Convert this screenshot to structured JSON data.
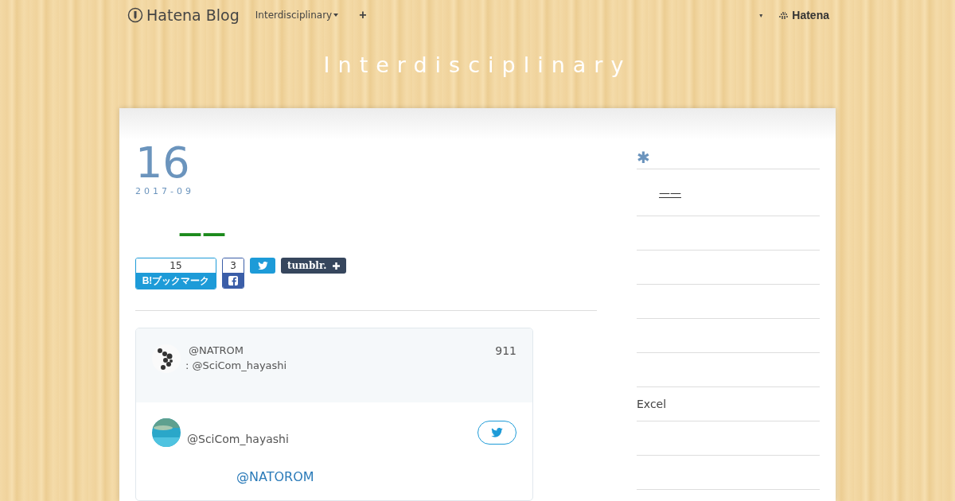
{
  "navbar": {
    "logo": "Hatena Blog",
    "blog_menu": "Interdisciplinary",
    "add": "+",
    "account_caret": "▾",
    "hatena": "Hatena"
  },
  "blog_title": "Interdisciplinary",
  "entry": {
    "day": "16",
    "month": "2017-09",
    "title": "——",
    "share": {
      "bookmark_count": "15",
      "bookmark_label": "B!ブックマーク",
      "facebook_count": "3",
      "tumblr_label": "tumblr."
    },
    "tweet": {
      "quoted_user": "@NATROM",
      "quoted_reply": ": @SciCom_hayashi",
      "quoted_count": "911",
      "user": "@SciCom_hayashi",
      "mention": "@NATOROM"
    }
  },
  "sidebar": {
    "heading": "✱",
    "items": [
      {
        "kind": "link",
        "text": "——"
      },
      {
        "kind": "blank"
      },
      {
        "kind": "blank"
      },
      {
        "kind": "blank"
      },
      {
        "kind": "blank"
      },
      {
        "kind": "blank"
      },
      {
        "kind": "text",
        "text": "Excel"
      },
      {
        "kind": "blank"
      },
      {
        "kind": "blank"
      }
    ]
  }
}
